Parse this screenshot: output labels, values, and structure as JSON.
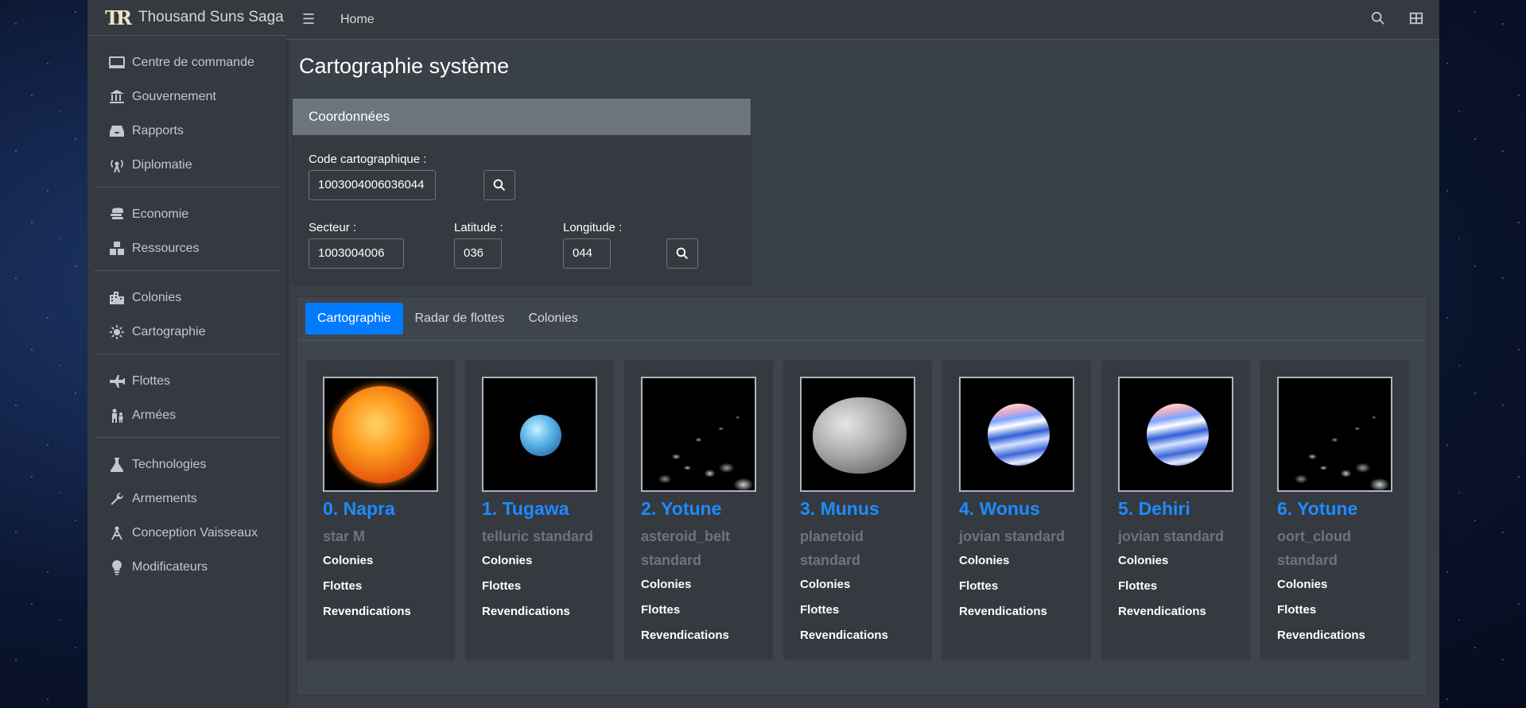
{
  "brand": {
    "logo_text": "ТR",
    "name": "Thousand Suns Saga"
  },
  "topbar": {
    "menu_icon": "☰",
    "home_label": "Home"
  },
  "sidebar": {
    "groups": [
      [
        {
          "label": "Centre de commande",
          "icon": "monitor-icon"
        },
        {
          "label": "Gouvernement",
          "icon": "landmark-icon"
        },
        {
          "label": "Rapports",
          "icon": "inbox-icon"
        },
        {
          "label": "Diplomatie",
          "icon": "broadcast-icon"
        }
      ],
      [
        {
          "label": "Economie",
          "icon": "coins-icon"
        },
        {
          "label": "Ressources",
          "icon": "boxes-icon"
        }
      ],
      [
        {
          "label": "Colonies",
          "icon": "city-icon"
        },
        {
          "label": "Cartographie",
          "icon": "sun-icon"
        }
      ],
      [
        {
          "label": "Flottes",
          "icon": "plane-icon"
        },
        {
          "label": "Armées",
          "icon": "soldiers-icon"
        }
      ],
      [
        {
          "label": "Technologies",
          "icon": "flask-icon"
        },
        {
          "label": "Armements",
          "icon": "wrench-icon"
        },
        {
          "label": "Conception Vaisseaux",
          "icon": "drafting-icon"
        },
        {
          "label": "Modificateurs",
          "icon": "lightbulb-icon"
        }
      ]
    ]
  },
  "page": {
    "title": "Cartographie système"
  },
  "coords": {
    "header": "Coordonnées",
    "code_label": "Code cartographique :",
    "code_value": "1003004006036044",
    "sector_label": "Secteur :",
    "sector_value": "1003004006",
    "lat_label": "Latitude :",
    "lat_value": "036",
    "lon_label": "Longitude :",
    "lon_value": "044"
  },
  "tabs": [
    "Cartographie",
    "Radar de flottes",
    "Colonies"
  ],
  "planets": [
    {
      "name": "0. Napra",
      "type": "star M",
      "art": "sun"
    },
    {
      "name": "1. Tugawa",
      "type": "telluric standard",
      "art": "earth"
    },
    {
      "name": "2. Yotune",
      "type": "asteroid_belt standard",
      "art": "asteroids"
    },
    {
      "name": "3. Munus",
      "type": "planetoid standard",
      "art": "vesta"
    },
    {
      "name": "4. Wonus",
      "type": "jovian standard",
      "art": "jovian"
    },
    {
      "name": "5. Dehiri",
      "type": "jovian standard",
      "art": "jovian"
    },
    {
      "name": "6. Yotune",
      "type": "oort_cloud standard",
      "art": "asteroids"
    }
  ],
  "planet_links": {
    "colonies": "Colonies",
    "fleets": "Flottes",
    "claims": "Revendications"
  },
  "colors": {
    "accent": "#007bff",
    "planet_name": "#1f8bff",
    "sidebar_bg": "#343a40",
    "content_bg": "#3a4047"
  }
}
